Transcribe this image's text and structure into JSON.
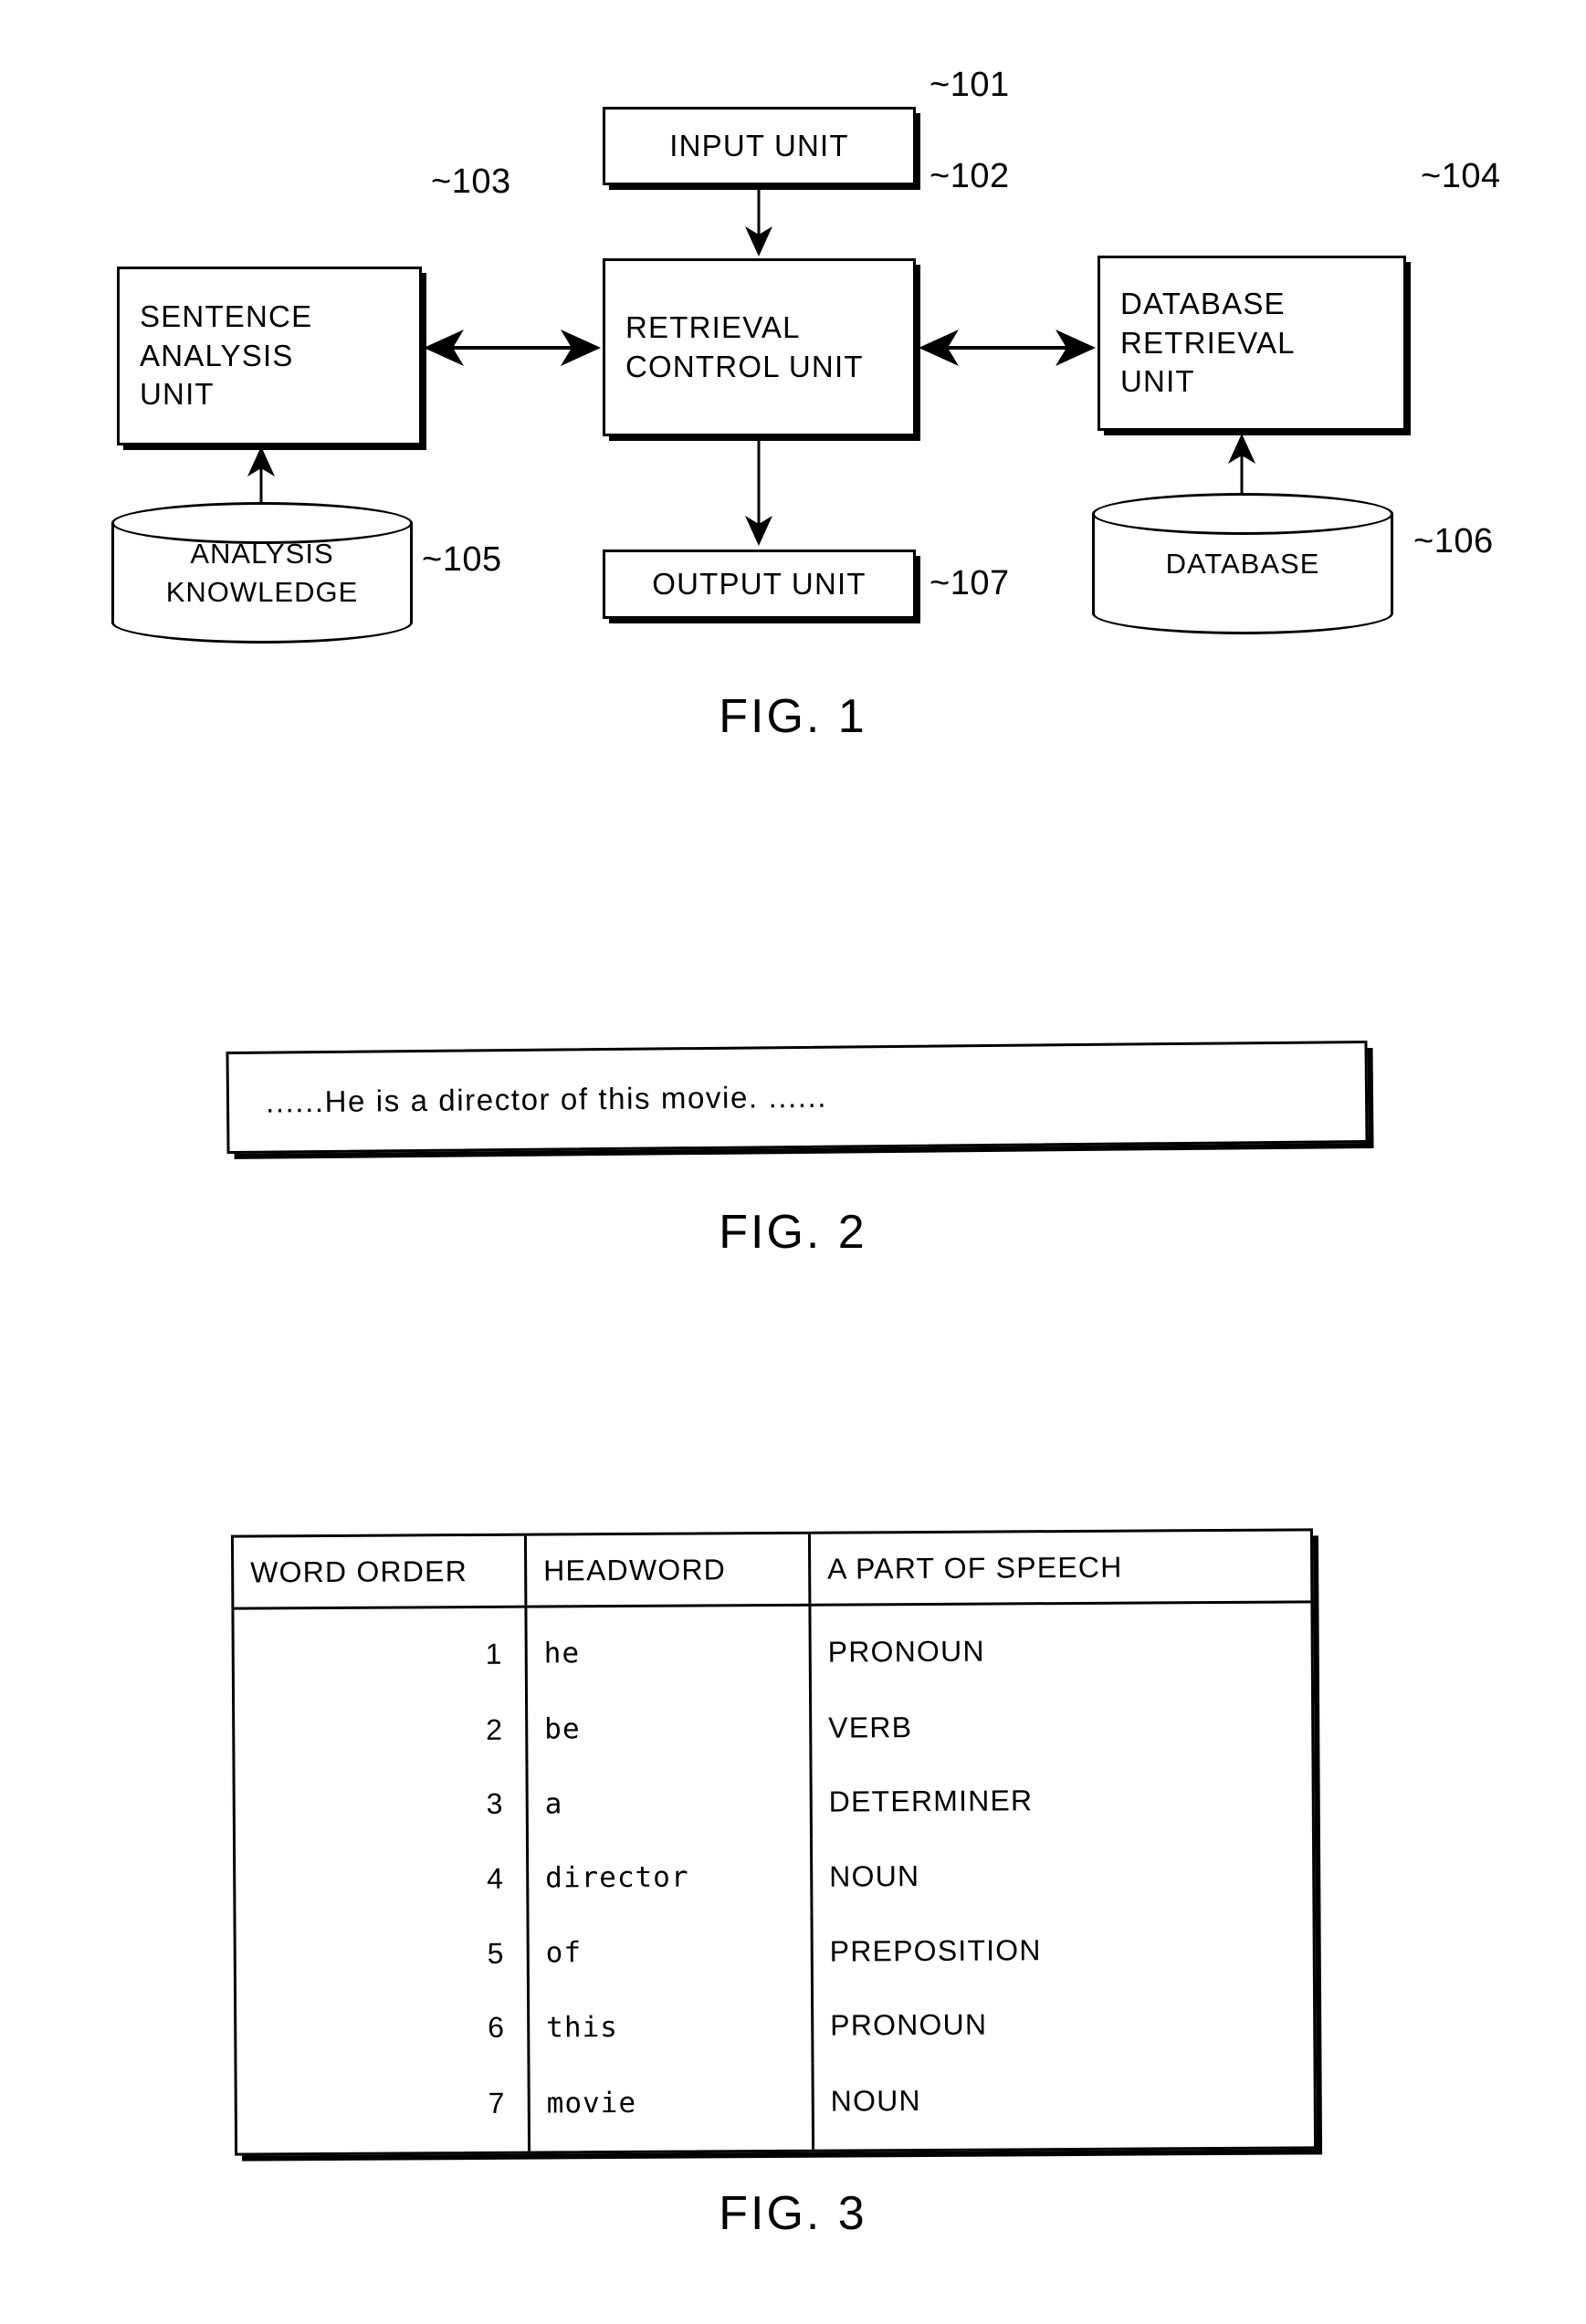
{
  "figures": [
    {
      "caption": "FIG. 1",
      "type": "block-diagram",
      "nodes": [
        {
          "ref": "101",
          "shape": "box",
          "lines": [
            "INPUT UNIT"
          ]
        },
        {
          "ref": "102",
          "shape": "box",
          "lines": [
            "RETRIEVAL",
            "CONTROL UNIT"
          ]
        },
        {
          "ref": "103",
          "shape": "box",
          "lines": [
            "SENTENCE",
            "ANALYSIS",
            "UNIT"
          ]
        },
        {
          "ref": "104",
          "shape": "box",
          "lines": [
            "DATABASE",
            "RETRIEVAL",
            "UNIT"
          ]
        },
        {
          "ref": "105",
          "shape": "cylinder",
          "lines": [
            "ANALYSIS",
            "KNOWLEDGE"
          ]
        },
        {
          "ref": "106",
          "shape": "cylinder",
          "lines": [
            "DATABASE"
          ]
        },
        {
          "ref": "107",
          "shape": "box",
          "lines": [
            "OUTPUT UNIT"
          ]
        }
      ],
      "connections": [
        {
          "from": "101",
          "to": "102",
          "direction": "one-way"
        },
        {
          "from": "103",
          "to": "102",
          "direction": "two-way"
        },
        {
          "from": "102",
          "to": "104",
          "direction": "two-way"
        },
        {
          "from": "105",
          "to": "103",
          "direction": "one-way"
        },
        {
          "from": "106",
          "to": "104",
          "direction": "one-way"
        },
        {
          "from": "102",
          "to": "107",
          "direction": "one-way"
        }
      ]
    },
    {
      "caption": "FIG. 2",
      "type": "sentence-box",
      "sentence": "......He is a director of this movie.  ......"
    },
    {
      "caption": "FIG. 3",
      "type": "table"
    }
  ],
  "fig1": {
    "caption": "FIG. 1",
    "input_unit": {
      "line1": "INPUT UNIT",
      "ref": "~101"
    },
    "retrieval_control_unit": {
      "line1": "RETRIEVAL",
      "line2": "CONTROL UNIT",
      "ref": "~102"
    },
    "sentence_analysis_unit": {
      "line1": "SENTENCE",
      "line2": "ANALYSIS",
      "line3": "UNIT",
      "ref": "~103"
    },
    "database_retrieval_unit": {
      "line1": "DATABASE",
      "line2": "RETRIEVAL",
      "line3": "UNIT",
      "ref": "~104"
    },
    "analysis_knowledge": {
      "line1": "ANALYSIS",
      "line2": "KNOWLEDGE",
      "ref": "~105"
    },
    "database": {
      "line1": "DATABASE",
      "ref": "~106"
    },
    "output_unit": {
      "line1": "OUTPUT UNIT",
      "ref": "~107"
    }
  },
  "fig2": {
    "caption": "FIG. 2",
    "sentence": "......He is a director of this movie.  ......"
  },
  "fig3": {
    "caption": "FIG. 3",
    "table": {
      "headers": [
        "WORD ORDER",
        "HEADWORD",
        "A PART OF SPEECH"
      ],
      "rows": [
        {
          "order": "1",
          "headword": "he",
          "pos": "PRONOUN"
        },
        {
          "order": "2",
          "headword": "be",
          "pos": "VERB"
        },
        {
          "order": "3",
          "headword": "a",
          "pos": "DETERMINER"
        },
        {
          "order": "4",
          "headword": "director",
          "pos": "NOUN"
        },
        {
          "order": "5",
          "headword": "of",
          "pos": "PREPOSITION"
        },
        {
          "order": "6",
          "headword": "this",
          "pos": "PRONOUN"
        },
        {
          "order": "7",
          "headword": "movie",
          "pos": "NOUN"
        }
      ]
    }
  },
  "colors": {
    "ink": "#000000",
    "paper": "#ffffff"
  }
}
